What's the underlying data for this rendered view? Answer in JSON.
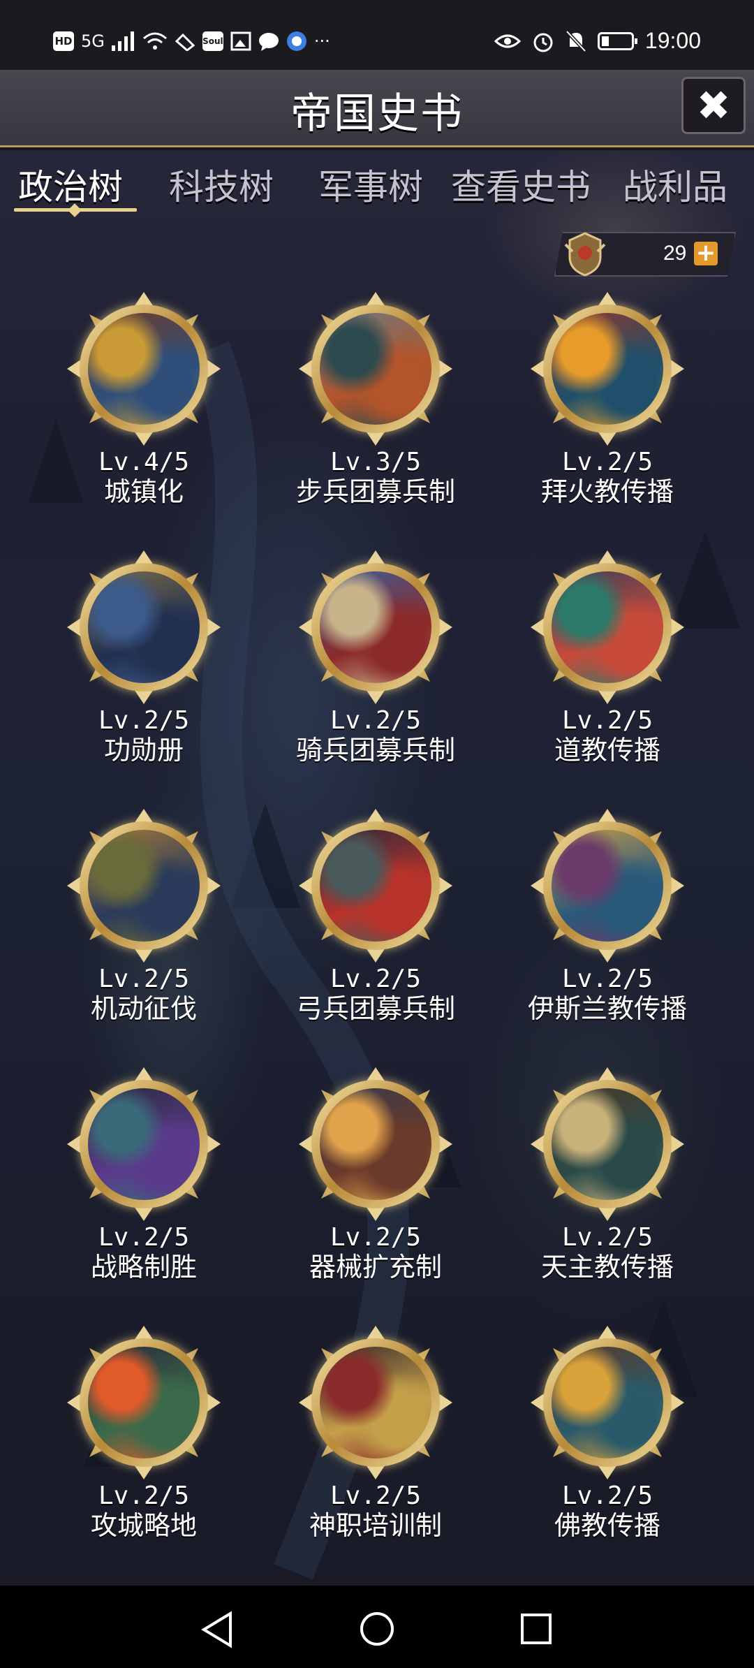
{
  "status_bar": {
    "time": "19:00",
    "left_icons": [
      "HD",
      "5G",
      "signal-icon",
      "wifi-icon",
      "app-icon",
      "Soul",
      "image-icon",
      "chat-icon",
      "browser-icon"
    ],
    "more": "···",
    "right_icons": [
      "eye-icon",
      "alarm-icon",
      "mute-icon",
      "battery-icon"
    ]
  },
  "header": {
    "title": "帝国史书",
    "close_label": "✖"
  },
  "tabs": [
    {
      "label": "政治树",
      "active": true
    },
    {
      "label": "科技树",
      "active": false
    },
    {
      "label": "军事树",
      "active": false
    },
    {
      "label": "查看史书",
      "active": false
    },
    {
      "label": "战利品",
      "active": false
    }
  ],
  "currency": {
    "value": "29",
    "plus": "+"
  },
  "techs": [
    {
      "level": "Lv.4/5",
      "name": "城镇化",
      "colors": [
        "#c99a35",
        "#2f4f7a",
        "#6f3d2b"
      ]
    },
    {
      "level": "Lv.3/5",
      "name": "步兵团募兵制",
      "colors": [
        "#2d4a4e",
        "#b3542a",
        "#6c7a7d"
      ]
    },
    {
      "level": "Lv.2/5",
      "name": "拜火教传播",
      "colors": [
        "#e79b2b",
        "#1f4f6a",
        "#8a3a2e"
      ]
    },
    {
      "level": "Lv.2/5",
      "name": "功勋册",
      "colors": [
        "#3c5a8a",
        "#223050",
        "#7a6b4a"
      ]
    },
    {
      "level": "Lv.2/5",
      "name": "骑兵团募兵制",
      "colors": [
        "#c7b38a",
        "#8c2a2a",
        "#3b5e9a"
      ]
    },
    {
      "level": "Lv.2/5",
      "name": "道教传播",
      "colors": [
        "#2b7a6a",
        "#c84a3a",
        "#3a3f5a"
      ]
    },
    {
      "level": "Lv.2/5",
      "name": "机动征伐",
      "colors": [
        "#6a6b3a",
        "#2a3a5a",
        "#a37a3a"
      ]
    },
    {
      "level": "Lv.2/5",
      "name": "弓兵团募兵制",
      "colors": [
        "#4a5a5a",
        "#b8332a",
        "#2a2a3a"
      ]
    },
    {
      "level": "Lv.2/5",
      "name": "伊斯兰教传播",
      "colors": [
        "#6a3a6a",
        "#2a5a7a",
        "#c49a4a"
      ]
    },
    {
      "level": "Lv.2/5",
      "name": "战略制胜",
      "colors": [
        "#3a6a7a",
        "#5a3a8a",
        "#2a2a3a"
      ]
    },
    {
      "level": "Lv.2/5",
      "name": "器械扩充制",
      "colors": [
        "#e0a24a",
        "#6a3a2a",
        "#3a3a4a"
      ]
    },
    {
      "level": "Lv.2/5",
      "name": "天主教传播",
      "colors": [
        "#c9b27a",
        "#2a4a4a",
        "#4a3a2a"
      ]
    },
    {
      "level": "Lv.2/5",
      "name": "攻城略地",
      "colors": [
        "#e05a2a",
        "#3a6a4a",
        "#2a2a3a"
      ]
    },
    {
      "level": "Lv.2/5",
      "name": "神职培训制",
      "colors": [
        "#8a2a2a",
        "#c4a04a",
        "#3a2a2a"
      ]
    },
    {
      "level": "Lv.2/5",
      "name": "佛教传播",
      "colors": [
        "#d9a23a",
        "#2a5a6a",
        "#5a3a2a"
      ]
    }
  ],
  "nav": [
    "back-icon",
    "home-icon",
    "recents-icon"
  ]
}
